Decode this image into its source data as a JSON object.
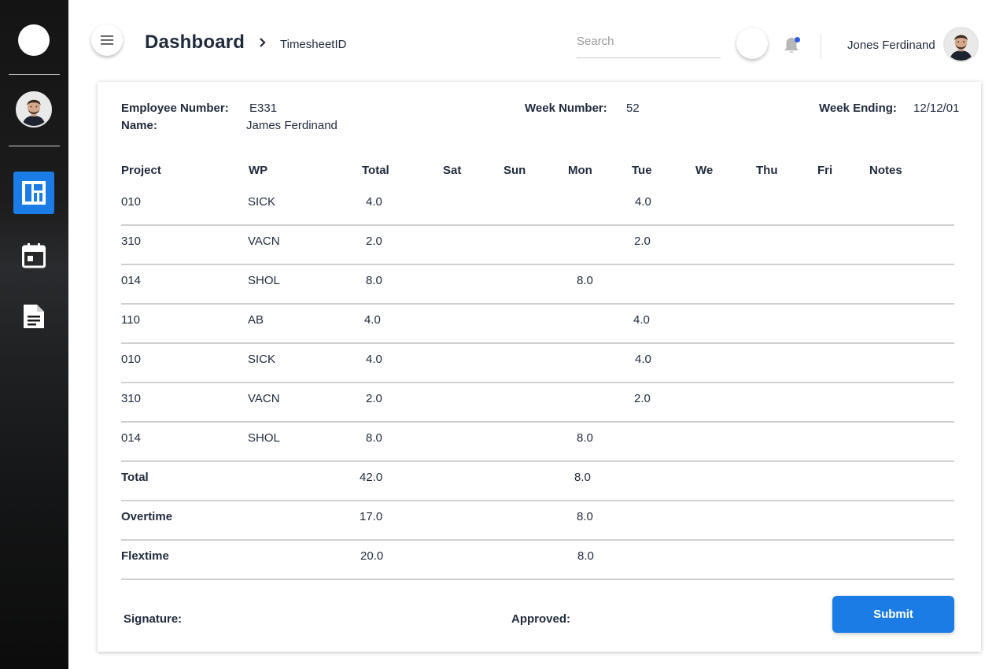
{
  "header": {
    "title": "Dashboard",
    "breadcrumb": "TimesheetID",
    "search_placeholder": "Search",
    "user_name": "Jones Ferdinand",
    "notification_dot": true
  },
  "sidebar": {
    "items": [
      {
        "icon": "dashboard-icon",
        "active": true
      },
      {
        "icon": "calendar-icon",
        "active": false
      },
      {
        "icon": "document-icon",
        "active": false
      }
    ]
  },
  "timesheet": {
    "employee_number_label": "Employee Number:",
    "employee_number": "E331",
    "name_label": "Name:",
    "name": "James Ferdinand",
    "week_number_label": "Week Number:",
    "week_number": "52",
    "week_ending_label": "Week Ending:",
    "week_ending": "12/12/01",
    "columns": [
      "Project",
      "WP",
      "Total",
      "Sat",
      "Sun",
      "Mon",
      "Tue",
      "We",
      "Thu",
      "Fri",
      "Notes"
    ],
    "rows": [
      {
        "project": "010",
        "wp": "SICK",
        "total": "4.0",
        "sat": "",
        "sun": "",
        "mon": "",
        "tue": "4.0",
        "we": "",
        "thu": "",
        "fri": "",
        "notes": ""
      },
      {
        "project": "310",
        "wp": "VACN",
        "total": "2.0",
        "sat": "",
        "sun": "",
        "mon": "",
        "tue": "2.0",
        "we": "",
        "thu": "",
        "fri": "",
        "notes": ""
      },
      {
        "project": "014",
        "wp": "SHOL",
        "total": "8.0",
        "sat": "",
        "sun": "",
        "mon": "8.0",
        "tue": "",
        "we": "",
        "thu": "",
        "fri": "",
        "notes": ""
      },
      {
        "project": "110",
        "wp": "AB",
        "total": "4.0",
        "sat": "",
        "sun": "",
        "mon": "",
        "tue": "4.0",
        "we": "",
        "thu": "",
        "fri": "",
        "notes": ""
      },
      {
        "project": "010",
        "wp": "SICK",
        "total": "4.0",
        "sat": "",
        "sun": "",
        "mon": "",
        "tue": "4.0",
        "we": "",
        "thu": "",
        "fri": "",
        "notes": ""
      },
      {
        "project": "310",
        "wp": "VACN",
        "total": "2.0",
        "sat": "",
        "sun": "",
        "mon": "",
        "tue": "2.0",
        "we": "",
        "thu": "",
        "fri": "",
        "notes": ""
      },
      {
        "project": "014",
        "wp": "SHOL",
        "total": "8.0",
        "sat": "",
        "sun": "",
        "mon": "8.0",
        "tue": "",
        "we": "",
        "thu": "",
        "fri": "",
        "notes": ""
      }
    ],
    "summary": [
      {
        "label": "Total",
        "total": "42.0",
        "mon": "8.0"
      },
      {
        "label": "Overtime",
        "total": "17.0",
        "mon": "8.0"
      },
      {
        "label": "Flextime",
        "total": "20.0",
        "mon": "8.0"
      }
    ],
    "signature_label": "Signature:",
    "approved_label": "Approved:",
    "submit_label": "Submit"
  },
  "colors": {
    "accent": "#1b7ce6",
    "sidebar_bg": "#141414",
    "text": "#1f2a3c",
    "notification": "#2f5bea"
  }
}
